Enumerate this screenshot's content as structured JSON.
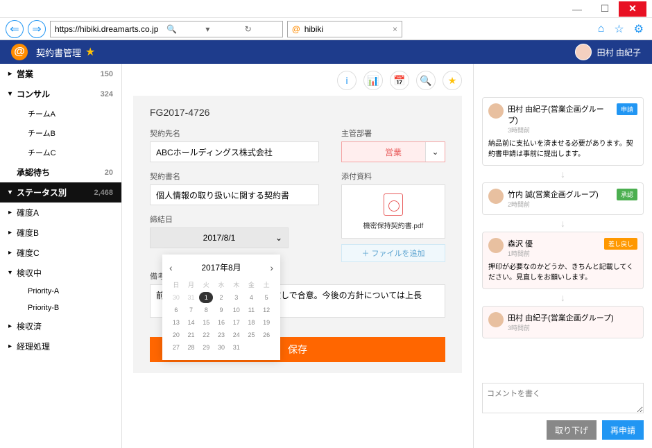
{
  "browser": {
    "url": "https://hibiki.dreamarts.co.jp",
    "tab_title": "hibiki"
  },
  "app": {
    "title": "契約書管理",
    "user_name": "田村 由紀子"
  },
  "sidebar": {
    "items": [
      {
        "label": "営業",
        "count": "150",
        "caret": "▸",
        "bold": true
      },
      {
        "label": "コンサル",
        "count": "324",
        "caret": "▾",
        "bold": true
      },
      {
        "label": "チームA",
        "child": true
      },
      {
        "label": "チームB",
        "child": true
      },
      {
        "label": "チームC",
        "child": true
      },
      {
        "label": "承認待ち",
        "count": "20",
        "bold": true
      },
      {
        "label": "ステータス別",
        "count": "2,468",
        "caret": "▾",
        "bold": true,
        "selected": true
      },
      {
        "label": "確度A",
        "caret": "▸"
      },
      {
        "label": "確度B",
        "caret": "▸"
      },
      {
        "label": "確度C",
        "caret": "▸"
      },
      {
        "label": "検収中",
        "caret": "▾"
      },
      {
        "label": "Priority-A",
        "child": true
      },
      {
        "label": "Priority-B",
        "child": true
      },
      {
        "label": "検収済",
        "caret": "▸"
      },
      {
        "label": "経理処理",
        "caret": "▸"
      }
    ]
  },
  "form": {
    "id": "FG2017-4726",
    "labels": {
      "contract_party": "契約先名",
      "department": "主管部署",
      "contract_name": "契約書名",
      "attachment": "添付資料",
      "date": "締結日",
      "notes": "備考欄"
    },
    "contract_party": "ABCホールディングス株式会社",
    "department": "営業",
    "contract_name": "個人情報の取り扱いに関する契約書",
    "date": "2017/8/1",
    "file_name": "機密保持契約書.pdf",
    "add_file": "＋ ファイルを追加",
    "notes": "前回　　　　　　　　　　　　渡しで合意。今後の方針については上長　",
    "save": "保存"
  },
  "calendar": {
    "title": "2017年8月",
    "dow": [
      "日",
      "月",
      "火",
      "水",
      "木",
      "金",
      "土"
    ],
    "prev_days": [
      "30",
      "31"
    ],
    "days": [
      "1",
      "2",
      "3",
      "4",
      "5",
      "6",
      "7",
      "8",
      "9",
      "10",
      "11",
      "12",
      "13",
      "14",
      "15",
      "16",
      "17",
      "18",
      "19",
      "20",
      "21",
      "22",
      "23",
      "24",
      "25",
      "26",
      "27",
      "28",
      "29",
      "30",
      "31"
    ],
    "today": "1"
  },
  "timeline": [
    {
      "name": "田村 由紀子(営業企画グループ)",
      "time": "3時間前",
      "badge": "申請",
      "badge_cls": "blue",
      "body": "納品前に支払いを済ませる必要があります。契約書申請は事前に提出します。"
    },
    {
      "name": "竹内 誠(営業企画グループ)",
      "time": "2時間前",
      "badge": "承認",
      "badge_cls": "green"
    },
    {
      "name": "森沢 優",
      "time": "1時間前",
      "badge": "差し戻し",
      "badge_cls": "orange",
      "body": "押印が必要なのかどうか、きちんと記載してください。見直しをお願いします。",
      "red": true
    },
    {
      "name": "田村 由紀子(営業企画グループ)",
      "time": "3時間前",
      "red": true
    }
  ],
  "actions": {
    "comment_placeholder": "コメントを書く",
    "withdraw": "取り下げ",
    "resubmit": "再申請"
  }
}
